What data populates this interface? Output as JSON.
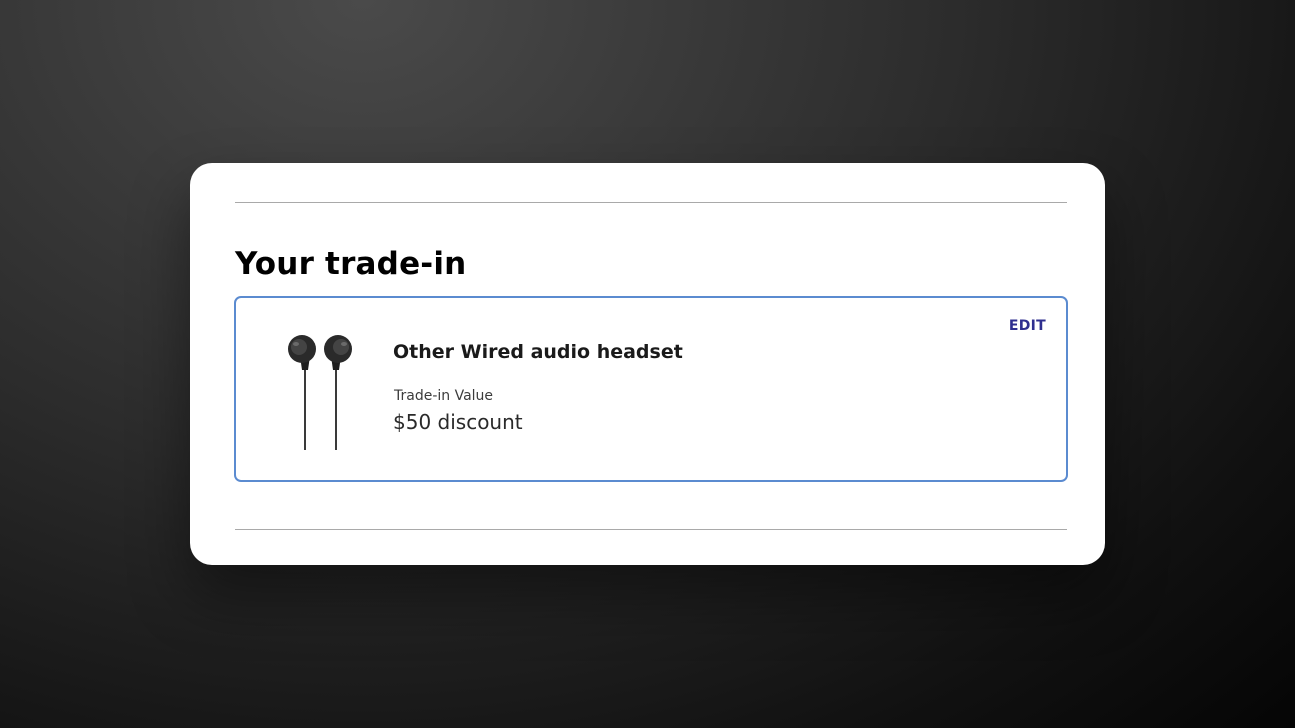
{
  "trade_in": {
    "section_title": "Your trade-in",
    "product_name": "Other Wired audio headset",
    "value_label": "Trade-in Value",
    "value_amount": "$50 discount",
    "edit_label": "EDIT",
    "product_icon": "wired-earphones-icon"
  },
  "colors": {
    "accent_border": "#5b8bd0",
    "edit_link": "#2f2f8f",
    "divider": "#a9a9a9"
  }
}
